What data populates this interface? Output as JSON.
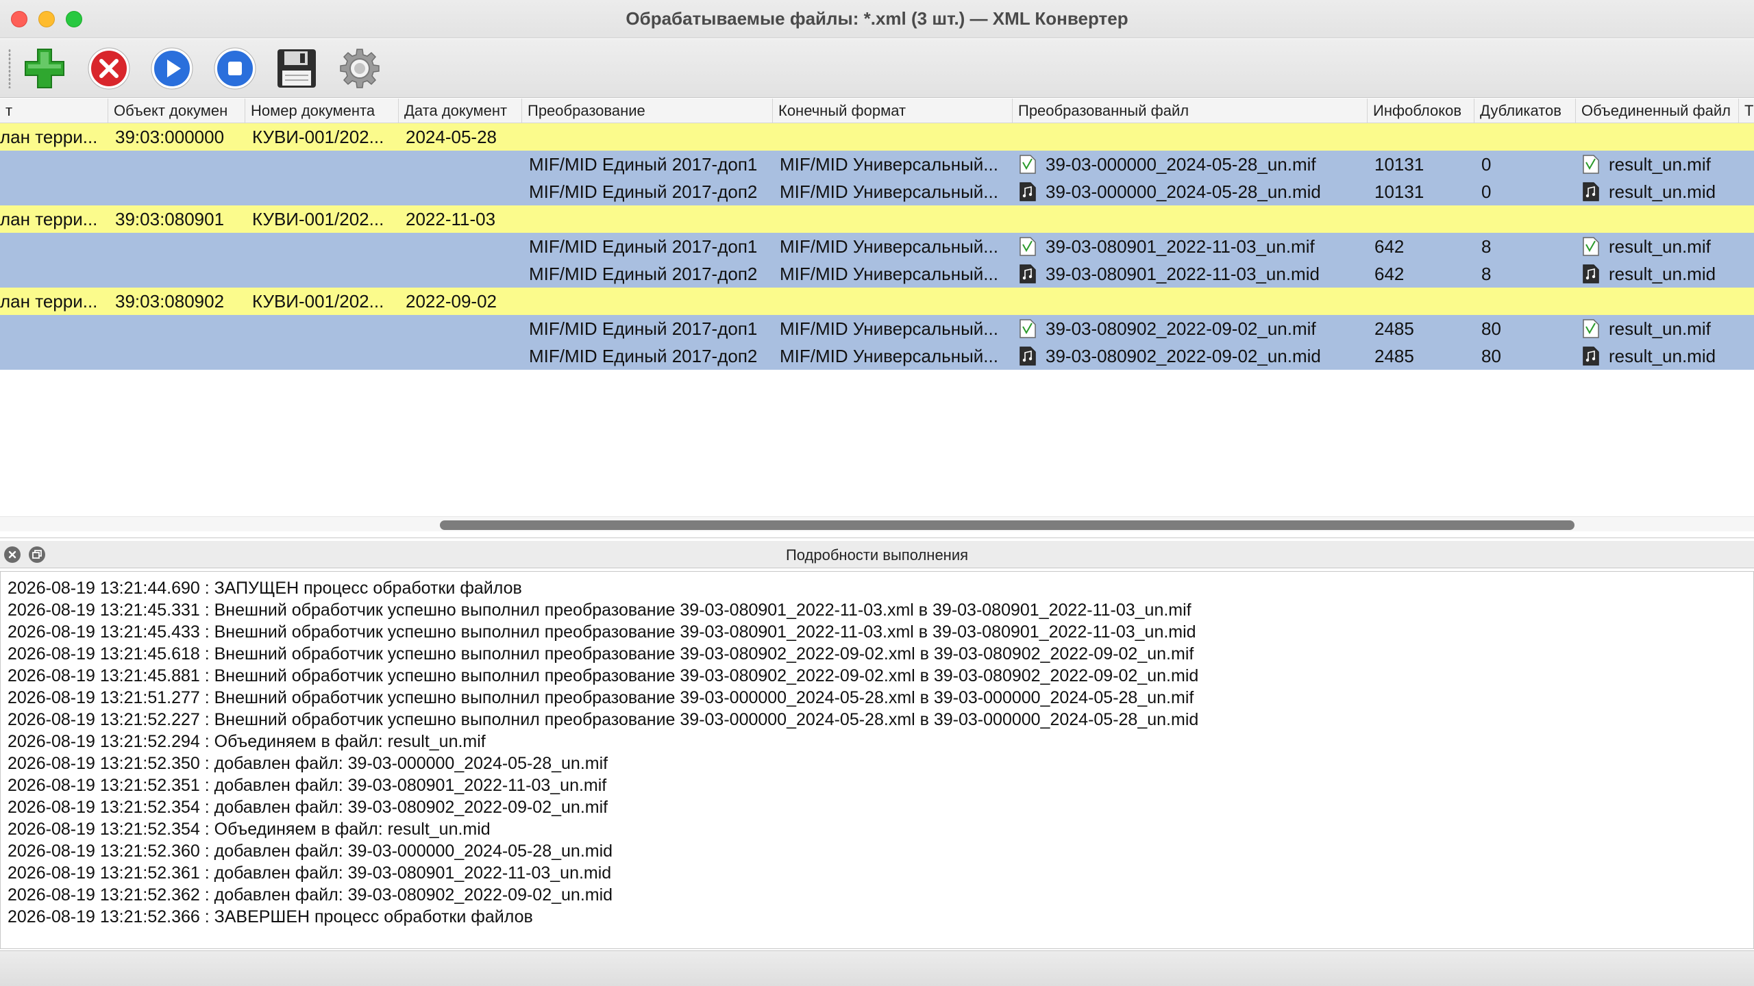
{
  "window": {
    "title": "Обрабатываемые файлы: *.xml (3 шт.) — XML Конвертер"
  },
  "toolbar": {
    "buttons": [
      {
        "name": "add",
        "icon": "plus-icon"
      },
      {
        "name": "remove",
        "icon": "remove-icon"
      },
      {
        "name": "run",
        "icon": "play-icon"
      },
      {
        "name": "stop",
        "icon": "stop-icon"
      },
      {
        "name": "save",
        "icon": "floppy-icon"
      },
      {
        "name": "settings",
        "icon": "gear-icon"
      }
    ]
  },
  "table": {
    "columns": {
      "c0": "т",
      "c1": "Объект докумен",
      "c2": "Номер документа",
      "c3": "Дата документ",
      "c4": "Преобразование",
      "c5": "Конечный формат",
      "c6": "Преобразованный файл",
      "c7": "Инфоблоков",
      "c8": "Дубликатов",
      "c9": "Объединенный файл",
      "c10": "Т"
    },
    "rows": [
      {
        "c0": "лан терри...",
        "c1": "39:03:000000",
        "c2": "КУВИ-001/202...",
        "c3": "2024-05-28"
      },
      {
        "c4": "MIF/MID Единый 2017-доп1",
        "c5": "MIF/MID Универсальный...",
        "c6": "39-03-000000_2024-05-28_un.mif",
        "c7": "10131",
        "c8": "0",
        "c9": "result_un.mif"
      },
      {
        "c4": "MIF/MID Единый 2017-доп2",
        "c5": "MIF/MID Универсальный...",
        "c6": "39-03-000000_2024-05-28_un.mid",
        "c7": "10131",
        "c8": "0",
        "c9": "result_un.mid"
      },
      {
        "c0": "лан терри...",
        "c1": "39:03:080901",
        "c2": "КУВИ-001/202...",
        "c3": "2022-11-03"
      },
      {
        "c4": "MIF/MID Единый 2017-доп1",
        "c5": "MIF/MID Универсальный...",
        "c6": "39-03-080901_2022-11-03_un.mif",
        "c7": "642",
        "c8": "8",
        "c9": "result_un.mif"
      },
      {
        "c4": "MIF/MID Единый 2017-доп2",
        "c5": "MIF/MID Универсальный...",
        "c6": "39-03-080901_2022-11-03_un.mid",
        "c7": "642",
        "c8": "8",
        "c9": "result_un.mid"
      },
      {
        "c0": "лан терри...",
        "c1": "39:03:080902",
        "c2": "КУВИ-001/202...",
        "c3": "2022-09-02"
      },
      {
        "c4": "MIF/MID Единый 2017-доп1",
        "c5": "MIF/MID Универсальный...",
        "c6": "39-03-080902_2022-09-02_un.mif",
        "c7": "2485",
        "c8": "80",
        "c9": "result_un.mif"
      },
      {
        "c4": "MIF/MID Единый 2017-доп2",
        "c5": "MIF/MID Универсальный...",
        "c6": "39-03-080902_2022-09-02_un.mid",
        "c7": "2485",
        "c8": "80",
        "c9": "result_un.mid"
      }
    ]
  },
  "details": {
    "title": "Подробности выполнения",
    "log": [
      "2026-08-19 13:21:44.690 : ЗАПУЩЕН процесс обработки файлов",
      "2026-08-19 13:21:45.331 : Внешний обработчик успешно выполнил преобразование 39-03-080901_2022-11-03.xml в 39-03-080901_2022-11-03_un.mif",
      "2026-08-19 13:21:45.433 : Внешний обработчик успешно выполнил преобразование 39-03-080901_2022-11-03.xml в 39-03-080901_2022-11-03_un.mid",
      "2026-08-19 13:21:45.618 : Внешний обработчик успешно выполнил преобразование 39-03-080902_2022-09-02.xml в 39-03-080902_2022-09-02_un.mif",
      "2026-08-19 13:21:45.881 : Внешний обработчик успешно выполнил преобразование 39-03-080902_2022-09-02.xml в 39-03-080902_2022-09-02_un.mid",
      "2026-08-19 13:21:51.277 : Внешний обработчик успешно выполнил преобразование 39-03-000000_2024-05-28.xml в 39-03-000000_2024-05-28_un.mif",
      "2026-08-19 13:21:52.227 : Внешний обработчик успешно выполнил преобразование 39-03-000000_2024-05-28.xml в 39-03-000000_2024-05-28_un.mid",
      "2026-08-19 13:21:52.294 : Объединяем в файл: result_un.mif",
      "2026-08-19 13:21:52.350 : добавлен файл: 39-03-000000_2024-05-28_un.mif",
      "2026-08-19 13:21:52.351 : добавлен файл: 39-03-080901_2022-11-03_un.mif",
      "2026-08-19 13:21:52.354 : добавлен файл: 39-03-080902_2022-09-02_un.mif",
      "2026-08-19 13:21:52.354 : Объединяем в файл: result_un.mid",
      "2026-08-19 13:21:52.360 : добавлен файл: 39-03-000000_2024-05-28_un.mid",
      "2026-08-19 13:21:52.361 : добавлен файл: 39-03-080901_2022-11-03_un.mid",
      "2026-08-19 13:21:52.362 : добавлен файл: 39-03-080902_2022-09-02_un.mid",
      "2026-08-19 13:21:52.366 : ЗАВЕРШЕН процесс обработки файлов"
    ]
  },
  "colors": {
    "parent_row": "#fbfb8c",
    "child_row": "#a9bfe0"
  }
}
